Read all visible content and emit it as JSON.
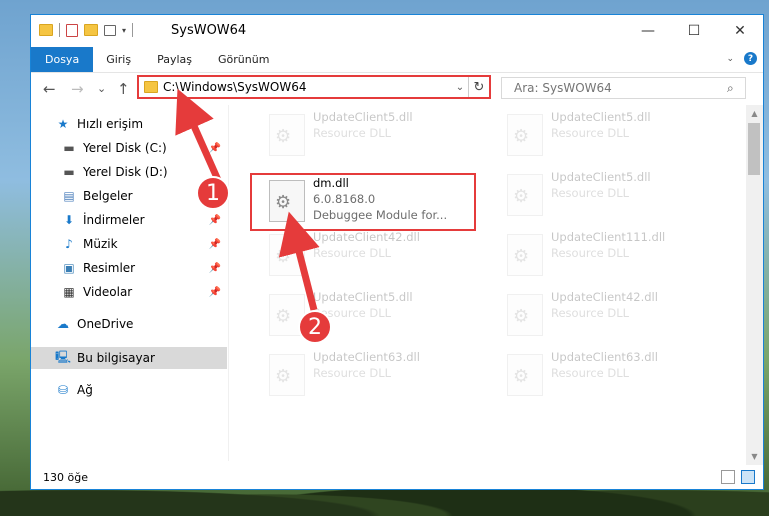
{
  "window": {
    "title": "SysWOW64",
    "controls": {
      "minimize": "—",
      "maximize": "☐",
      "close": "✕"
    }
  },
  "ribbon": {
    "tabs": [
      "Dosya",
      "Giriş",
      "Paylaş",
      "Görünüm"
    ],
    "help": "?"
  },
  "nav": {
    "back": "←",
    "forward": "→",
    "recent": "⌄",
    "up": "↑",
    "address": "C:\\Windows\\SysWOW64",
    "search_placeholder": "Ara: SysWOW64"
  },
  "sidebar": {
    "items": [
      {
        "label": "Hızlı erişim",
        "icon": "star-icon",
        "pinned": false
      },
      {
        "label": "Yerel Disk (C:)",
        "icon": "drive-icon",
        "pinned": true
      },
      {
        "label": "Yerel Disk (D:)",
        "icon": "drive-icon",
        "pinned": true
      },
      {
        "label": "Belgeler",
        "icon": "document-icon",
        "pinned": true
      },
      {
        "label": "İndirmeler",
        "icon": "download-icon",
        "pinned": true
      },
      {
        "label": "Müzik",
        "icon": "music-icon",
        "pinned": true
      },
      {
        "label": "Resimler",
        "icon": "pictures-icon",
        "pinned": true
      },
      {
        "label": "Videolar",
        "icon": "video-icon",
        "pinned": true
      },
      {
        "label": "OneDrive",
        "icon": "cloud-icon",
        "pinned": false
      },
      {
        "label": "Bu bilgisayar",
        "icon": "computer-icon",
        "pinned": false,
        "selected": true
      },
      {
        "label": "Ağ",
        "icon": "network-icon",
        "pinned": false
      }
    ]
  },
  "files": [
    {
      "name": "UpdateClient5.dll",
      "desc": "Resource DLL",
      "faded": true
    },
    {
      "name": "UpdateClient5.dll",
      "desc": "Resource DLL",
      "faded": true
    },
    {
      "name": "dm.dll",
      "version": "6.0.8168.0",
      "desc": "Debuggee Module for...",
      "faded": false
    },
    {
      "name": "UpdateClient5.dll",
      "desc": "Resource DLL",
      "faded": true
    },
    {
      "name": "UpdateClient42.dll",
      "desc": "Resource DLL",
      "faded": true
    },
    {
      "name": "UpdateClient111.dll",
      "desc": "Resource DLL",
      "faded": true
    },
    {
      "name": "UpdateClient5.dll",
      "desc": "Resource DLL",
      "faded": true
    },
    {
      "name": "UpdateClient42.dll",
      "desc": "Resource DLL",
      "faded": true
    },
    {
      "name": "UpdateClient63.dll",
      "desc": "Resource DLL",
      "faded": true
    },
    {
      "name": "UpdateClient63.dll",
      "desc": "Resource DLL",
      "faded": true
    }
  ],
  "status": {
    "count": "130 öğe"
  },
  "annotations": {
    "step1": "1",
    "step2": "2",
    "color": "#e53b3b"
  }
}
